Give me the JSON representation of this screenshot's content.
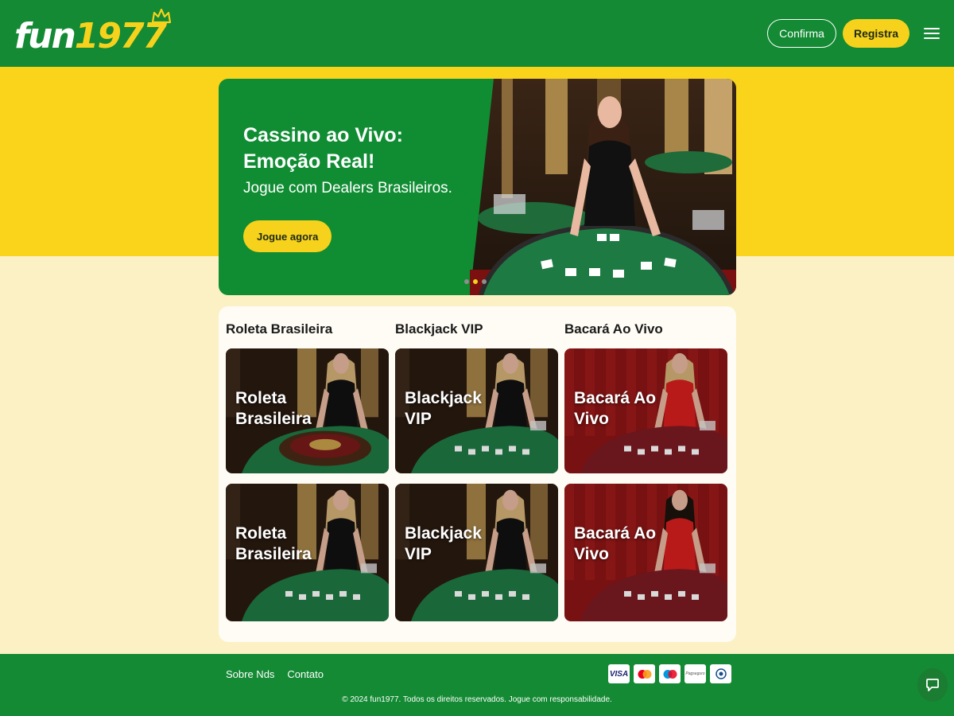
{
  "header": {
    "logo_prefix": "fun",
    "logo_number": "1977",
    "confirm_label": "Confirma",
    "register_label": "Registra"
  },
  "hero": {
    "title": "Cassino ao Vivo: Emoção Real!",
    "subtitle": "Jogue com Dealers Brasileiros.",
    "cta_label": "Jogue agora",
    "slide_count": 3,
    "active_slide": 2
  },
  "games": {
    "columns": [
      "Roleta Brasileira",
      "Blackjack VIP",
      "Bacará Ao Vivo"
    ],
    "tiles": [
      {
        "label": "Roleta Brasileira",
        "scene": "roulette"
      },
      {
        "label": "Blackjack VIP",
        "scene": "blackjack"
      },
      {
        "label": "Bacará Ao Vivo",
        "scene": "baccarat"
      },
      {
        "label": "Roleta Brasileira",
        "scene": "blackjack"
      },
      {
        "label": "Blackjack VIP",
        "scene": "blackjack"
      },
      {
        "label": "Bacará Ao Vivo",
        "scene": "baccarat"
      }
    ]
  },
  "footer": {
    "links": [
      "Sobre Nds",
      "Contato"
    ],
    "payments": [
      "VISA",
      "mastercard",
      "maestro",
      "Pagseguro",
      "Elo"
    ],
    "copyright": "© 2024 fun1977. Todos os direitos reservados. Jogue com responsabilidade."
  },
  "colors": {
    "brand_green": "#138a33",
    "brand_yellow": "#f9d41a",
    "page_cream": "#fbf1c4"
  }
}
